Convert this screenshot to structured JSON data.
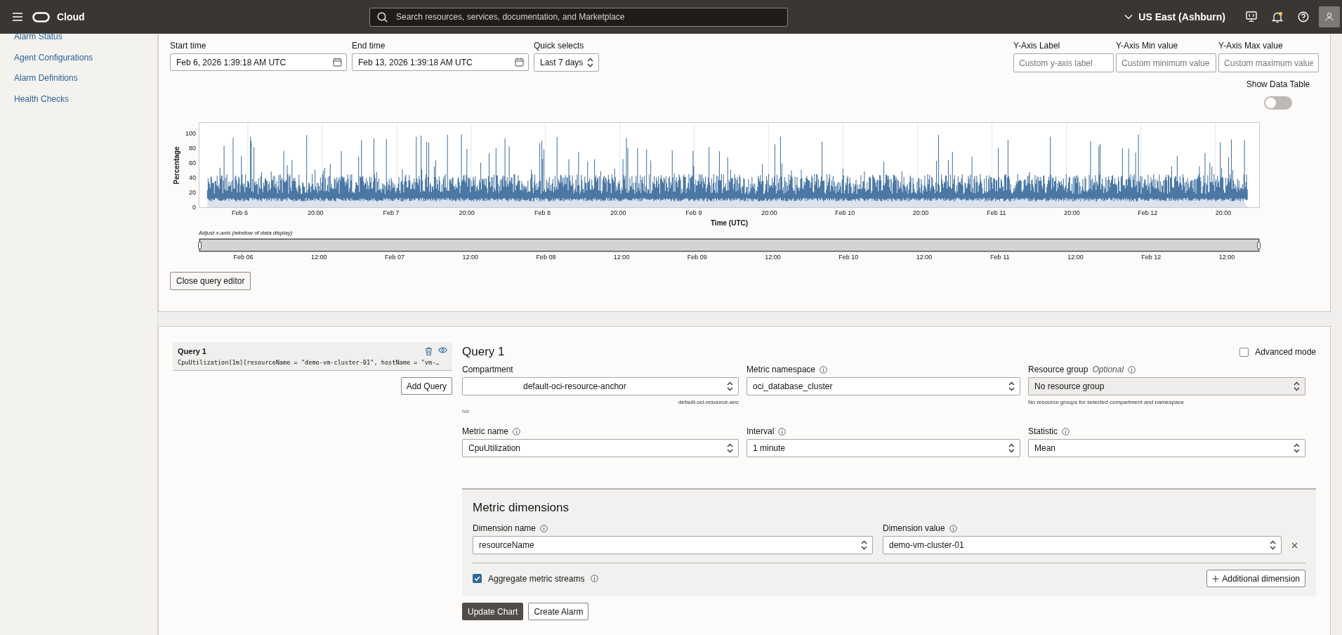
{
  "top_bar": {
    "brand": "Cloud",
    "search_placeholder": "Search resources, services, documentation, and Marketplace",
    "region": "US East (Ashburn)"
  },
  "sidebar": {
    "items": [
      "Alarm Status",
      "Agent Configurations",
      "Alarm Definitions",
      "Health Checks"
    ]
  },
  "time_range": [
    {
      "label": "Start time",
      "value": "Feb 6, 2026 1:39:18 AM UTC",
      "kind": "date"
    },
    {
      "label": "End time",
      "value": "Feb 13, 2026 1:39:18 AM UTC",
      "kind": "date"
    },
    {
      "label": "Quick selects",
      "value": "Last 7 days",
      "kind": "select"
    }
  ],
  "y_axis_options": [
    {
      "label": "Y-Axis Label",
      "placeholder": "Custom y-axis label"
    },
    {
      "label": "Y-Axis Min value",
      "placeholder": "Custom minimum value"
    },
    {
      "label": "Y-Axis Max value",
      "placeholder": "Custom maximum value"
    }
  ],
  "show_data_table": {
    "label": "Show Data Table",
    "on": false
  },
  "chart": {
    "ylabel": "Percentage",
    "xlabel": "Time (UTC)",
    "yticks": [
      "100",
      "80",
      "60",
      "40",
      "20",
      "0"
    ],
    "xticks": [
      "Feb 6",
      "20:00",
      "Feb 7",
      "20:00",
      "Feb 8",
      "20:00",
      "Feb 9",
      "20:00",
      "Feb 10",
      "20:00",
      "Feb 11",
      "20:00",
      "Feb 12",
      "20:00"
    ],
    "range_label": "Adjust x-axis (window of data display)",
    "range": {
      "level": 1
    },
    "range_ticks": [
      "Feb 06",
      "12:00",
      "Feb 07",
      "12:00",
      "Feb 08",
      "12:00",
      "Feb 09",
      "12:00",
      "Feb 10",
      "12:00",
      "Feb 11",
      "12:00",
      "Feb 12",
      "12:00"
    ]
  },
  "close_button": "Close query editor",
  "queries": [
    {
      "title": "Query 1",
      "expression": "CpuUtilization[1m]{resourceName = \"demo-vm-cluster-01\", hostName = \"vm-…",
      "selected": true
    }
  ],
  "add_query": "Add Query",
  "editor": {
    "title": "Query 1",
    "advanced_mode": {
      "label": "Advanced mode",
      "checked": false
    },
    "fields": [
      {
        "label": "Compartment",
        "info": false,
        "value": "default-oci-resource-anchor",
        "helper": "default-oci-resource-anc",
        "note": "nor",
        "disabled": false
      },
      {
        "label": "Metric namespace",
        "info": true,
        "value": "oci_database_cluster",
        "disabled": false
      },
      {
        "label": "Resource group",
        "optional": "Optional",
        "info": true,
        "value": "No resource group",
        "helper": "No resource groups for selected compartment and namespace",
        "disabled": true
      },
      {
        "label": "Metric name",
        "info": true,
        "value": "CpuUtilization",
        "disabled": false
      },
      {
        "label": "Interval",
        "info": true,
        "value": "1 minute",
        "disabled": false
      },
      {
        "label": "Statistic",
        "info": true,
        "value": "Mean",
        "disabled": false
      }
    ]
  },
  "dimensions": {
    "title": "Metric dimensions",
    "rows": [
      {
        "name_label": "Dimension name",
        "name": "resourceName",
        "value_label": "Dimension value",
        "value": "demo-vm-cluster-01"
      }
    ],
    "aggregate": {
      "label": "Aggregate metric streams",
      "checked": true
    },
    "add_button": "Additional dimension"
  },
  "actions": [
    {
      "label": "Update Chart",
      "primary": true
    },
    {
      "label": "Create Alarm",
      "primary": false
    }
  ]
}
